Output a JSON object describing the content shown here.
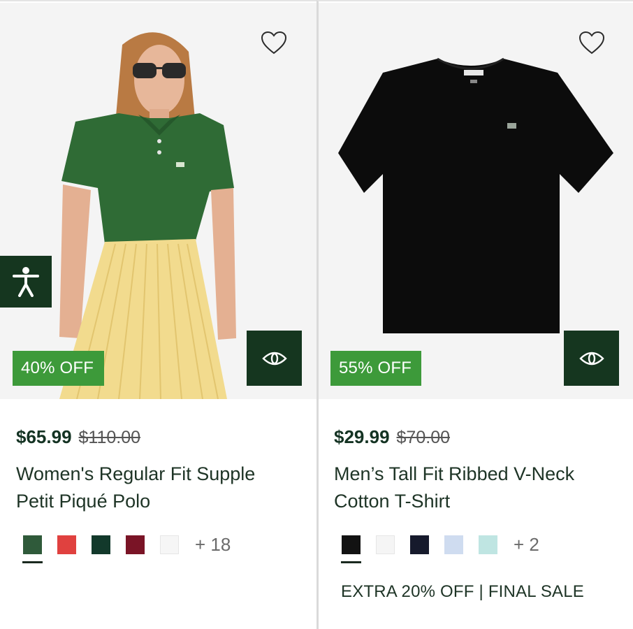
{
  "products": [
    {
      "name": "Women's Regular Fit Supple Petit Piqué Polo",
      "title_line1": "Women's Regular Fit Supple",
      "title_line2": "Petit Piqué Polo",
      "price_now": "$65.99",
      "price_was": "$110.00",
      "discount_badge": "40% OFF",
      "image_icon": "woman-green-polo-photo",
      "swatches": [
        "#2f5a3a",
        "#e0413f",
        "#12392b",
        "#7a1426",
        "#f6f6f6"
      ],
      "selected_swatch": 0,
      "more_colors": "+ 18",
      "promo": ""
    },
    {
      "name": "Men’s Tall Fit Ribbed V-Neck Cotton T-Shirt",
      "title_line1": "Men’s Tall Fit Ribbed V-Neck",
      "title_line2": "Cotton T-Shirt",
      "price_now": "$29.99",
      "price_was": "$70.00",
      "discount_badge": "55% OFF",
      "image_icon": "black-tshirt-photo",
      "swatches": [
        "#121212",
        "#f5f5f5",
        "#161a2c",
        "#cfdcf0",
        "#bfe5e2"
      ],
      "selected_swatch": 0,
      "more_colors": "+ 2",
      "promo": "EXTRA 20% OFF | FINAL SALE"
    }
  ],
  "icons": {
    "wishlist": "heart-outline-icon",
    "quickview": "eye-icon",
    "accessibility": "accessibility-person-icon"
  },
  "colors": {
    "badge_green": "#3d9a3a",
    "dark_green": "#15361f",
    "text_green": "#143323"
  }
}
